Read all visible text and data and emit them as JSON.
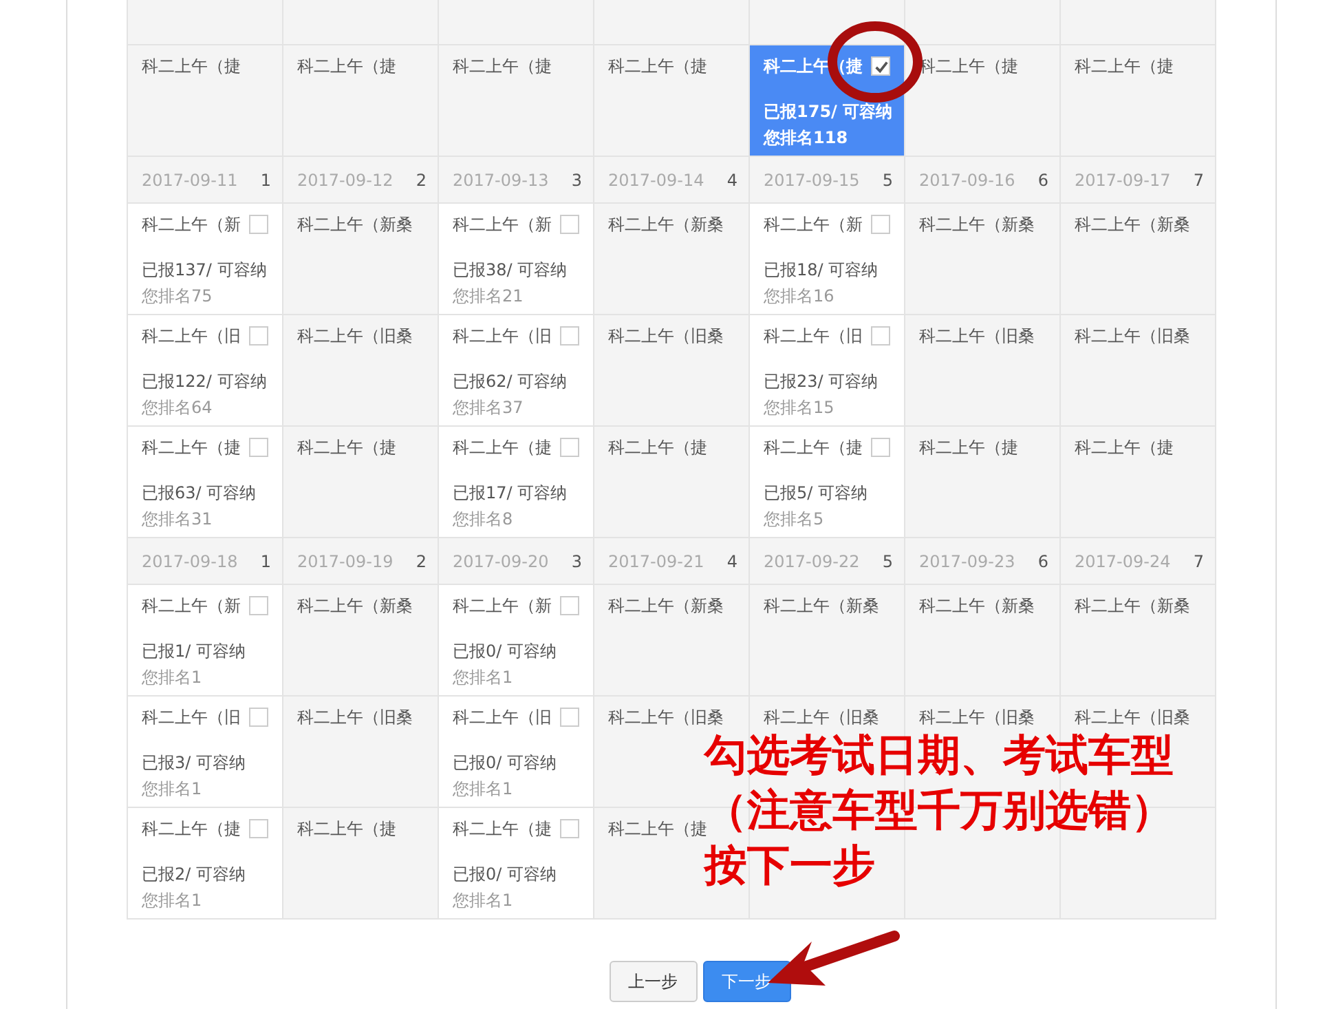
{
  "table": {
    "sections": [
      {
        "rows": [
          [
            {
              "kind": "closed"
            },
            {
              "kind": "closed"
            },
            {
              "kind": "closed"
            },
            {
              "kind": "closed"
            },
            {
              "kind": "closed"
            },
            {
              "kind": "closed"
            },
            {
              "kind": "closed"
            }
          ],
          [
            {
              "kind": "closed",
              "name": "科二上午（捷"
            },
            {
              "kind": "closed",
              "name": "科二上午（捷"
            },
            {
              "kind": "closed",
              "name": "科二上午（捷"
            },
            {
              "kind": "closed",
              "name": "科二上午（捷"
            },
            {
              "kind": "available",
              "name": "科二上午（捷",
              "checked": true,
              "reported": "已报175/ 可容纳",
              "rank": "您排名118"
            },
            {
              "kind": "closed",
              "name": "科二上午（捷"
            },
            {
              "kind": "closed",
              "name": "科二上午（捷"
            }
          ]
        ]
      },
      {
        "dates": [
          {
            "date": "2017-09-11",
            "weekday": "1"
          },
          {
            "date": "2017-09-12",
            "weekday": "2"
          },
          {
            "date": "2017-09-13",
            "weekday": "3"
          },
          {
            "date": "2017-09-14",
            "weekday": "4"
          },
          {
            "date": "2017-09-15",
            "weekday": "5"
          },
          {
            "date": "2017-09-16",
            "weekday": "6"
          },
          {
            "date": "2017-09-17",
            "weekday": "7"
          }
        ],
        "rows": [
          [
            {
              "kind": "available",
              "name": "科二上午（新",
              "checked": false,
              "reported": "已报137/ 可容纳",
              "rank": "您排名75"
            },
            {
              "kind": "closed",
              "name": "科二上午（新桑"
            },
            {
              "kind": "available",
              "name": "科二上午（新",
              "checked": false,
              "reported": "已报38/ 可容纳",
              "rank": "您排名21"
            },
            {
              "kind": "closed",
              "name": "科二上午（新桑"
            },
            {
              "kind": "available",
              "name": "科二上午（新",
              "checked": false,
              "reported": "已报18/ 可容纳",
              "rank": "您排名16"
            },
            {
              "kind": "closed",
              "name": "科二上午（新桑"
            },
            {
              "kind": "closed",
              "name": "科二上午（新桑"
            }
          ],
          [
            {
              "kind": "available",
              "name": "科二上午（旧",
              "checked": false,
              "reported": "已报122/ 可容纳",
              "rank": "您排名64"
            },
            {
              "kind": "closed",
              "name": "科二上午（旧桑"
            },
            {
              "kind": "available",
              "name": "科二上午（旧",
              "checked": false,
              "reported": "已报62/ 可容纳",
              "rank": "您排名37"
            },
            {
              "kind": "closed",
              "name": "科二上午（旧桑"
            },
            {
              "kind": "available",
              "name": "科二上午（旧",
              "checked": false,
              "reported": "已报23/ 可容纳",
              "rank": "您排名15"
            },
            {
              "kind": "closed",
              "name": "科二上午（旧桑"
            },
            {
              "kind": "closed",
              "name": "科二上午（旧桑"
            }
          ],
          [
            {
              "kind": "available",
              "name": "科二上午（捷",
              "checked": false,
              "reported": "已报63/ 可容纳",
              "rank": "您排名31"
            },
            {
              "kind": "closed",
              "name": "科二上午（捷"
            },
            {
              "kind": "available",
              "name": "科二上午（捷",
              "checked": false,
              "reported": "已报17/ 可容纳",
              "rank": "您排名8"
            },
            {
              "kind": "closed",
              "name": "科二上午（捷"
            },
            {
              "kind": "available",
              "name": "科二上午（捷",
              "checked": false,
              "reported": "已报5/ 可容纳",
              "rank": "您排名5"
            },
            {
              "kind": "closed",
              "name": "科二上午（捷"
            },
            {
              "kind": "closed",
              "name": "科二上午（捷"
            }
          ]
        ]
      },
      {
        "dates": [
          {
            "date": "2017-09-18",
            "weekday": "1"
          },
          {
            "date": "2017-09-19",
            "weekday": "2"
          },
          {
            "date": "2017-09-20",
            "weekday": "3"
          },
          {
            "date": "2017-09-21",
            "weekday": "4"
          },
          {
            "date": "2017-09-22",
            "weekday": "5"
          },
          {
            "date": "2017-09-23",
            "weekday": "6"
          },
          {
            "date": "2017-09-24",
            "weekday": "7"
          }
        ],
        "rows": [
          [
            {
              "kind": "available",
              "name": "科二上午（新",
              "checked": false,
              "reported": "已报1/ 可容纳",
              "rank": "您排名1"
            },
            {
              "kind": "closed",
              "name": "科二上午（新桑"
            },
            {
              "kind": "available",
              "name": "科二上午（新",
              "checked": false,
              "reported": "已报0/ 可容纳",
              "rank": "您排名1"
            },
            {
              "kind": "closed",
              "name": "科二上午（新桑"
            },
            {
              "kind": "closed",
              "name": "科二上午（新桑"
            },
            {
              "kind": "closed",
              "name": "科二上午（新桑"
            },
            {
              "kind": "closed",
              "name": "科二上午（新桑"
            }
          ],
          [
            {
              "kind": "available",
              "name": "科二上午（旧",
              "checked": false,
              "reported": "已报3/ 可容纳",
              "rank": "您排名1"
            },
            {
              "kind": "closed",
              "name": "科二上午（旧桑"
            },
            {
              "kind": "available",
              "name": "科二上午（旧",
              "checked": false,
              "reported": "已报0/ 可容纳",
              "rank": "您排名1"
            },
            {
              "kind": "closed",
              "name": "科二上午（旧桑"
            },
            {
              "kind": "closed",
              "name": "科二上午（旧桑"
            },
            {
              "kind": "closed",
              "name": "科二上午（旧桑"
            },
            {
              "kind": "closed",
              "name": "科二上午（旧桑"
            }
          ],
          [
            {
              "kind": "available",
              "name": "科二上午（捷",
              "checked": false,
              "reported": "已报2/ 可容纳",
              "rank": "您排名1"
            },
            {
              "kind": "closed",
              "name": "科二上午（捷"
            },
            {
              "kind": "available",
              "name": "科二上午（捷",
              "checked": false,
              "reported": "已报0/ 可容纳",
              "rank": "您排名1"
            },
            {
              "kind": "closed",
              "name": "科二上午（捷"
            },
            {
              "kind": "closed"
            },
            {
              "kind": "closed"
            },
            {
              "kind": "closed"
            }
          ]
        ]
      }
    ]
  },
  "buttons": [
    {
      "label": "上一步",
      "kind": "secondary"
    },
    {
      "label": "下一步",
      "kind": "primary"
    }
  ],
  "annotation": {
    "lines": [
      "勾选考试日期、考试车型",
      "（注意车型千万别选错）",
      "按下一步"
    ]
  }
}
